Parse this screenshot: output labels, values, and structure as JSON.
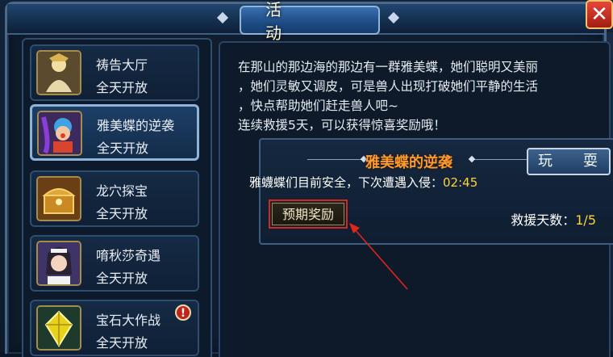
{
  "window": {
    "title": "活　动",
    "close_glyph": "✕"
  },
  "activities": [
    {
      "name": "祷告大厅",
      "status": "全天开放",
      "icon": "priest-icon",
      "active": false,
      "alert": false
    },
    {
      "name": "雅美蝶的逆袭",
      "status": "全天开放",
      "icon": "clown-icon",
      "active": true,
      "alert": false
    },
    {
      "name": "龙穴探宝",
      "status": "全天开放",
      "icon": "treasure-chest-icon",
      "active": false,
      "alert": false
    },
    {
      "name": "唷秋莎奇遇",
      "status": "全天开放",
      "icon": "maid-girl-icon",
      "active": false,
      "alert": false
    },
    {
      "name": "宝石大作战",
      "status": "全天开放",
      "icon": "gem-icon",
      "active": false,
      "alert": true
    }
  ],
  "alert_glyph": "!",
  "detail": {
    "description_lines": [
      "在那山的那边海的那边有一群雅美蝶，她们聪明又美丽",
      "，她们灵敏又调皮，可是兽人出现打破她们平静的生活",
      "，快点帮助她们赶走兽人吧~",
      "连续救援5天，可以获得惊喜奖励哦！"
    ],
    "event_title": "雅美蝶的逆袭",
    "play_button": "玩　耍",
    "status_prefix": "雅蠛蝶们目前安全，下次遭遇入侵：",
    "timer": "02:45",
    "reward_button": "预期奖励",
    "rescue_label": "救援天数：",
    "rescue_value": "1/5"
  },
  "colors": {
    "accent_orange": "#ff9a2e",
    "highlight_red": "#d3291c",
    "timer_yellow": "#ffd23a"
  }
}
